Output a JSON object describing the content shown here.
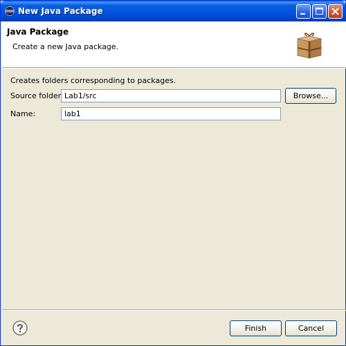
{
  "window": {
    "title": "New Java Package"
  },
  "header": {
    "title": "Java Package",
    "description": "Create a new Java package."
  },
  "body": {
    "description": "Creates folders corresponding to packages.",
    "source_folder_label": "Source folder:",
    "source_folder_value": "Lab1/src",
    "browse_label": "Browse...",
    "name_label": "Name:",
    "name_value": "lab1"
  },
  "footer": {
    "finish_label": "Finish",
    "cancel_label": "Cancel"
  },
  "icons": {
    "title": "eclipse-icon",
    "header": "package-box-icon",
    "help": "help-icon"
  },
  "colors": {
    "titlebar": "#0054e3",
    "dialog_bg": "#ece9d8",
    "field_border": "#7f9db9"
  }
}
